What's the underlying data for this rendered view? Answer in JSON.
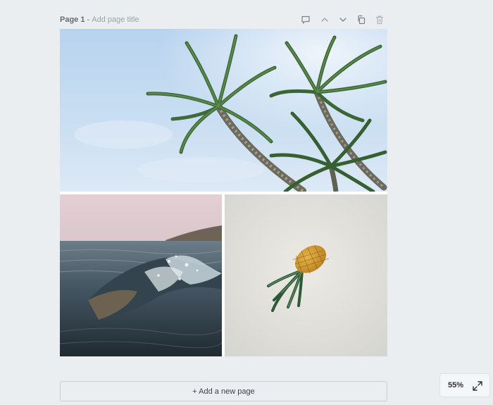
{
  "page": {
    "label": "Page 1",
    "separator": "-",
    "title_placeholder": "Add page title"
  },
  "toolbar": {
    "icons": [
      "comment-icon",
      "chevron-up-icon",
      "chevron-down-icon",
      "duplicate-icon",
      "trash-icon"
    ]
  },
  "images": [
    {
      "name": "palm-trees-photo",
      "subject": "palm trees against sky"
    },
    {
      "name": "ocean-wave-photo",
      "subject": "ocean wave"
    },
    {
      "name": "pineapple-photo",
      "subject": "pineapple on sand"
    }
  ],
  "add_page": {
    "label": "+ Add a new page"
  },
  "zoom": {
    "level": "55%",
    "expand_icon": "expand-icon"
  },
  "colors": {
    "background": "#ebeef1",
    "text_muted": "#9aa2ab",
    "text_dark": "#2f343a"
  }
}
